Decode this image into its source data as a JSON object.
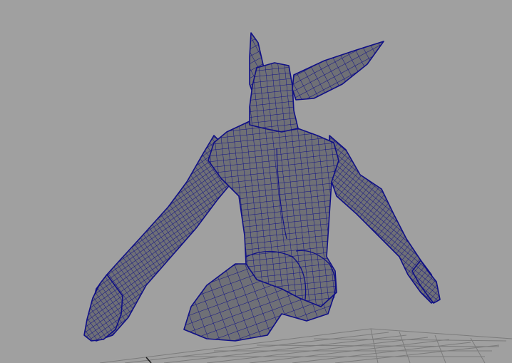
{
  "viewport": {
    "background": "#a0a0a0",
    "mesh_face_color": "#6f7076",
    "mesh_wire_color": "#0f0f86",
    "grid_color": "#7b7b7b",
    "grid_axis_color": "#1a1a1a"
  }
}
